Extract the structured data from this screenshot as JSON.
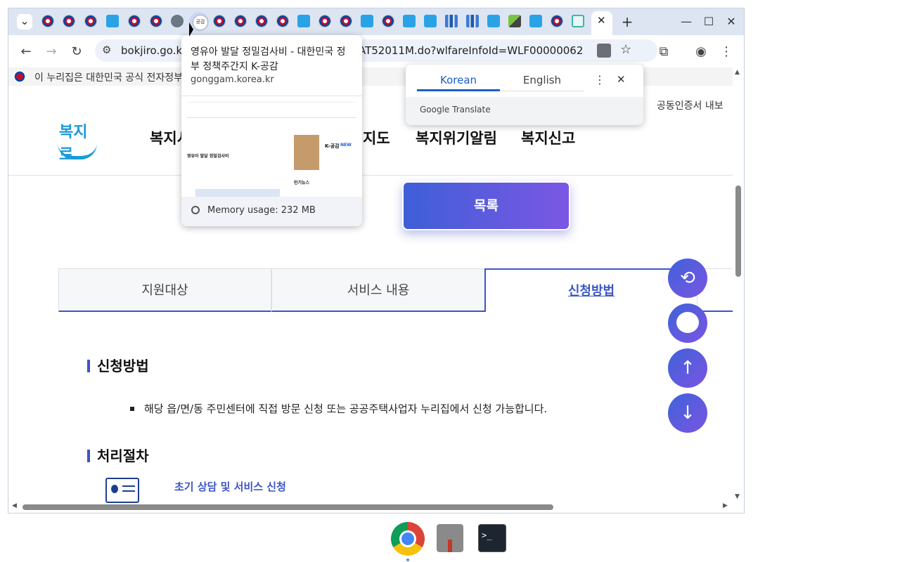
{
  "browser": {
    "address": {
      "host": "bokjiro.go.kr",
      "path_tail": "AT52011M.do?wlfareInfoId=WLF00000062"
    },
    "hover_card": {
      "title": "영유아 발달 정밀검사비 - 대한민국 정부 정책주간지 K-공감",
      "domain": "gonggam.korea.kr",
      "memory": "Memory usage: 232 MB",
      "thumb_tab_title": "영유아 발달 정밀검사비",
      "thumb_badge": "K-공감",
      "thumb_new": "NEW",
      "thumb_popular": "인기뉴스"
    },
    "tab_icon_label": "공감",
    "translate": {
      "lang1": "Korean",
      "lang2": "English",
      "brand": "Google Translate"
    }
  },
  "page": {
    "gov_banner": "이 누리집은 대한민국 공식 전자정부",
    "cert_link": "공동인증서 내보",
    "logo_text": "복지로",
    "gnb": [
      "복지서",
      "지도",
      "복지위기알림",
      "복지신고"
    ],
    "list_button": "목록",
    "tabs": [
      "지원대상",
      "서비스 내용",
      "신청방법"
    ],
    "section_apply": "신청방법",
    "apply_desc": "해당 읍/면/동 주민센터에 직접 방문 신청 또는 공공주택사업자 누리집에서 신청 가능합니다.",
    "section_process": "처리절차",
    "step1": "초기 상담 및 서비스 신청"
  },
  "colors": {
    "accent": "#3b56c4",
    "button_gradient_start": "#3e5fd8",
    "button_gradient_end": "#7b57e4"
  }
}
